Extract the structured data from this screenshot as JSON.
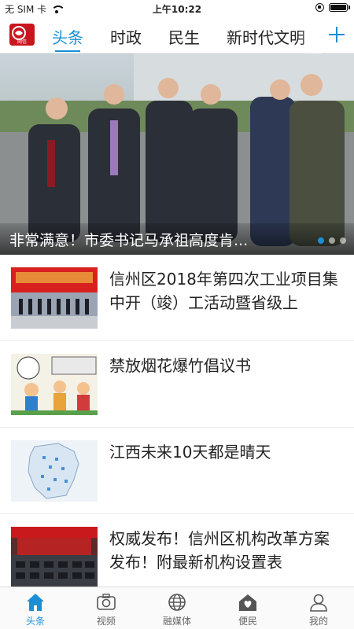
{
  "status_bar": {
    "carrier": "无 SIM 卡",
    "time": "上午10:22"
  },
  "header": {
    "logo_text": "网信",
    "tabs": [
      {
        "label": "头条",
        "active": true
      },
      {
        "label": "时政",
        "active": false
      },
      {
        "label": "民生",
        "active": false
      },
      {
        "label": "新时代文明",
        "active": false
      }
    ],
    "add_icon": "plus-icon"
  },
  "hero": {
    "title": "非常满意！市委书记马承祖高度肯...",
    "slides": 3,
    "active_slide": 1
  },
  "news": [
    {
      "title": "信州区2018年第四次工业项目集中开（竣）工活动暨省级上",
      "thumb": "ceremony-photo"
    },
    {
      "title": "禁放烟花爆竹倡议书",
      "thumb": "cartoon-illustration"
    },
    {
      "title": "江西未来10天都是晴天",
      "thumb": "weather-map"
    },
    {
      "title": "权威发布！信州区机构改革方案发布！附最新机构设置表",
      "thumb": "meeting-photo"
    }
  ],
  "tabbar": {
    "items": [
      {
        "label": "头条",
        "icon": "home-icon",
        "active": true
      },
      {
        "label": "视频",
        "icon": "camera-icon",
        "active": false
      },
      {
        "label": "融媒体",
        "icon": "globe-icon",
        "active": false
      },
      {
        "label": "便民",
        "icon": "heart-house-icon",
        "active": false
      },
      {
        "label": "我的",
        "icon": "user-icon",
        "active": false
      }
    ]
  },
  "colors": {
    "accent": "#1a8fd6",
    "logo_red": "#c8161d"
  }
}
